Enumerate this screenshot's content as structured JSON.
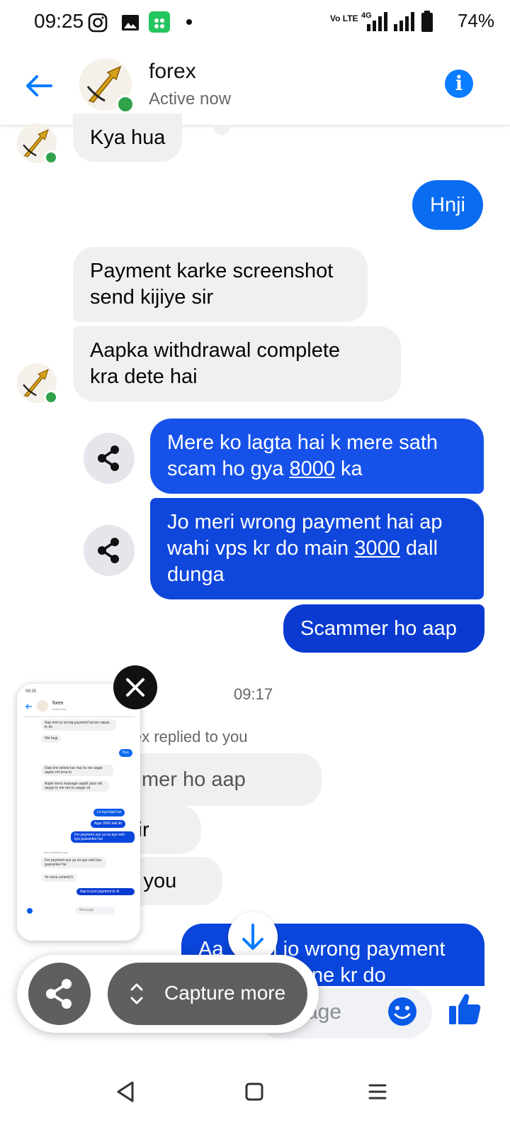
{
  "status_bar": {
    "time": "09:25",
    "battery": "74%",
    "network": "4G",
    "volte": "Vo LTE"
  },
  "header": {
    "title": "forex",
    "status": "Active now"
  },
  "messages": {
    "m1": "Kya hua",
    "m2": "Hnji",
    "m3_line1": "Payment karke screenshot",
    "m3_line2": "send kijiye sir",
    "m4_line1": "Aapka withdrawal complete",
    "m4_line2": "kra dete hai",
    "m5_line1": "Mere ko lagta hai k mere sath",
    "m5_line2_pre": "scam ho gya ",
    "m5_amount": "8000",
    "m5_line2_post": " ka",
    "m6_line1": "Jo meri wrong payment hai ap",
    "m6_line2_pre": "wahi vps kr do main ",
    "m6_amount": "3000",
    "m6_line2_post": " dall",
    "m6_line3": "dunga",
    "m7": "Scammer ho aap",
    "timestamp": "09:17",
    "reply_note": "ex  replied to you",
    "m8_fragment": "mer ho aap",
    "m9_fragment": "sir",
    "m10_fragment": "k you",
    "m11_fragment_a": "Aa",
    "m11_fragment_b": "ri jo wrong payment",
    "m11_fragment_c": "ne kr do"
  },
  "composer": {
    "placeholder_fragment": "age"
  },
  "overlay": {
    "capture_more": "Capture more"
  },
  "thumbnail": {
    "time": "09:25",
    "title": "forex",
    "status": "Active now",
    "t1": "Aap meri jo wrong payment hai wo vapas kr do",
    "t2": "Nhi hogi",
    "t3": "Kyu",
    "t4": "Date line delete kar mai hu me aagar aapko nhi lena to",
    "t5": "Aapki mera massage aapkil pass nhi aayge to me net on aayge sir",
    "t6": "Le kya baat hai",
    "t7": "Agar 3000 dall do",
    "t8": "Fer payment aye ya na aye eski kya guarantee hai",
    "t9": "forex replied to you",
    "t10": "Fer payment aye ya na aye eski kya guarantee hai",
    "t11": "Ye mera commit h",
    "t12": "Aap ki    puri payment kr di",
    "t_input": "Message"
  },
  "colors": {
    "messenger_blue": "#0a7cff",
    "bubble_out_top": "#1a5cf0",
    "bubble_out_bottom": "#0836c9",
    "bubble_in": "#f0f0f0",
    "online_green": "#31a24c"
  }
}
